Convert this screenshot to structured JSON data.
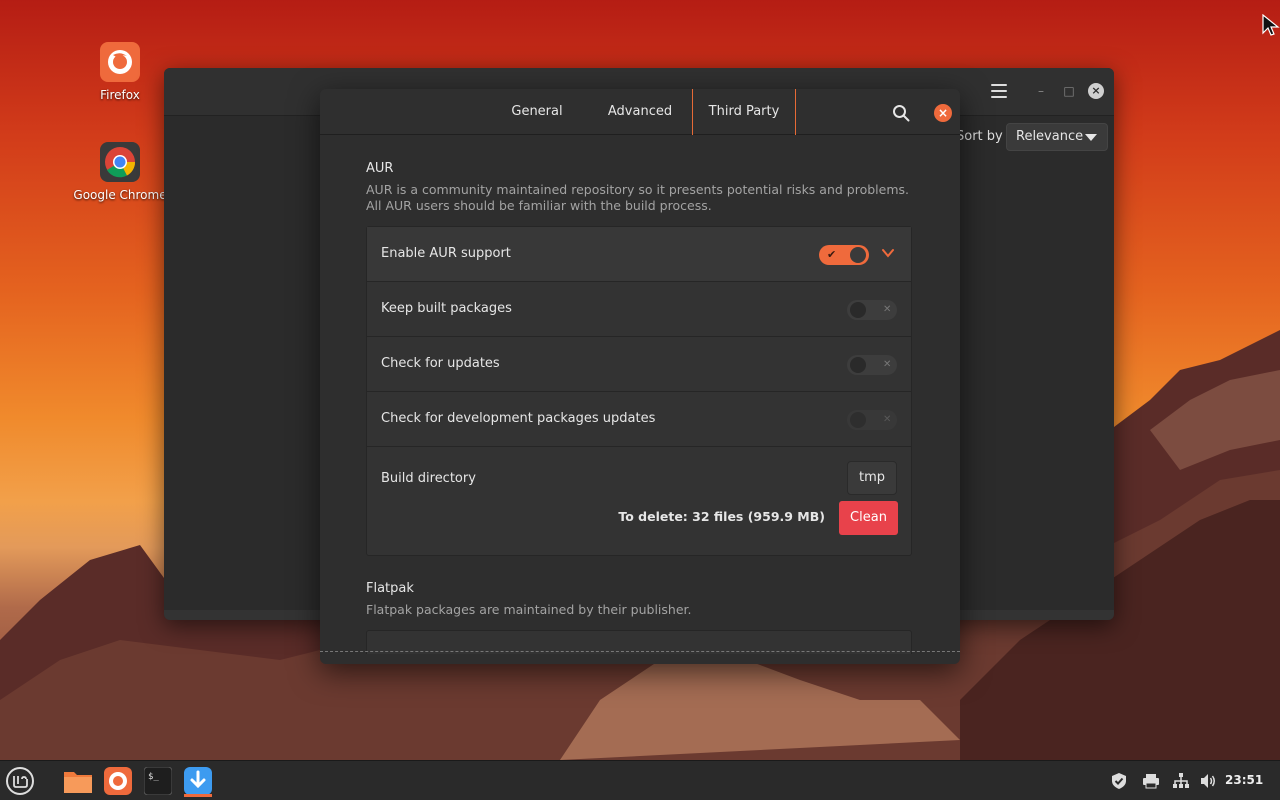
{
  "desktop": {
    "icons": [
      {
        "label": "Firefox",
        "icon": "firefox-icon"
      },
      {
        "label": "Google Chrome",
        "icon": "chrome-icon"
      }
    ]
  },
  "main_window": {
    "sort_by_label": "Sort by",
    "sort_by_value": "Relevance"
  },
  "dialog": {
    "tabs": [
      {
        "label": "General",
        "active": false
      },
      {
        "label": "Advanced",
        "active": false
      },
      {
        "label": "Third Party",
        "active": true
      }
    ],
    "aur": {
      "title": "AUR",
      "description_line1": "AUR is a community maintained repository so it presents potential risks and problems.",
      "description_line2": "All AUR users should be familiar with the build process.",
      "rows": [
        {
          "label": "Enable AUR support",
          "state": "on"
        },
        {
          "label": "Keep built packages",
          "state": "off"
        },
        {
          "label": "Check for updates",
          "state": "off"
        },
        {
          "label": "Check for development packages updates",
          "state": "off-disabled"
        }
      ],
      "build_directory": {
        "label": "Build directory",
        "button_label": "tmp",
        "to_delete_text": "To delete:  32 files  (959.9 MB)",
        "clean_label": "Clean"
      }
    },
    "flatpak": {
      "title": "Flatpak",
      "description": "Flatpak packages are maintained by their publisher."
    }
  },
  "taskbar": {
    "clock": "23:51"
  },
  "colors": {
    "accent": "#ef6a3c",
    "danger": "#e8424b",
    "window_bg": "#2e2e2e",
    "row_bg": "#333333"
  }
}
